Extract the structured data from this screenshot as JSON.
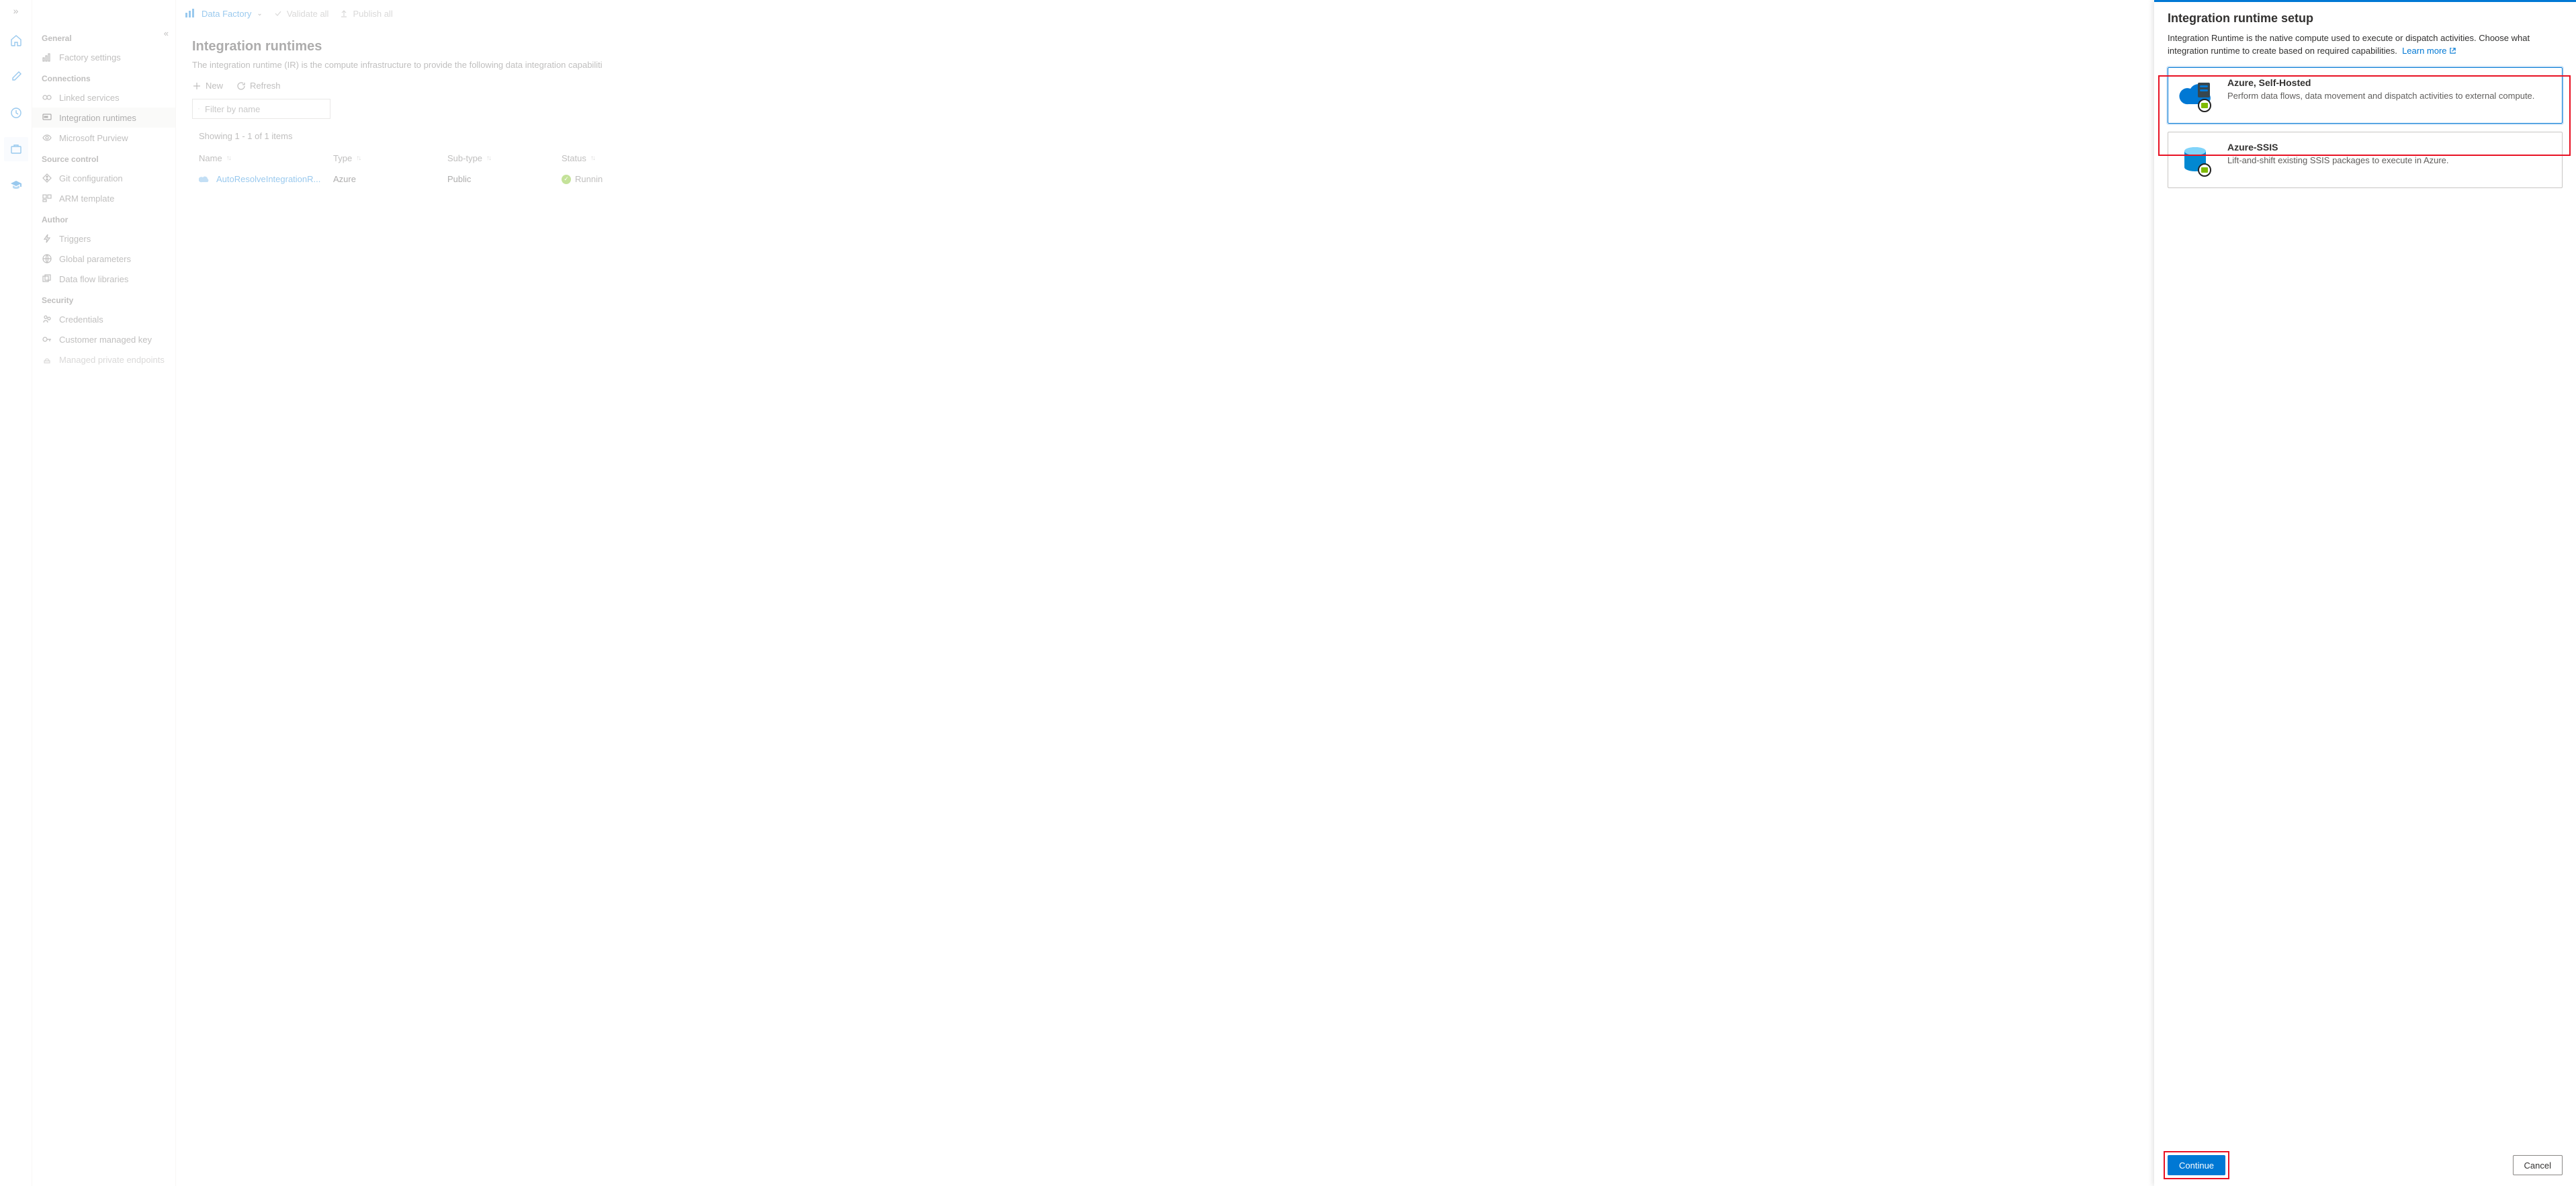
{
  "topbar": {
    "brand": "Data Factory",
    "validate": "Validate all",
    "publish": "Publish all"
  },
  "sidebar": {
    "groups": [
      {
        "title": "General",
        "items": [
          {
            "label": "Factory settings"
          }
        ]
      },
      {
        "title": "Connections",
        "items": [
          {
            "label": "Linked services"
          },
          {
            "label": "Integration runtimes",
            "active": true
          },
          {
            "label": "Microsoft Purview"
          }
        ]
      },
      {
        "title": "Source control",
        "items": [
          {
            "label": "Git configuration"
          },
          {
            "label": "ARM template"
          }
        ]
      },
      {
        "title": "Author",
        "items": [
          {
            "label": "Triggers"
          },
          {
            "label": "Global parameters"
          },
          {
            "label": "Data flow libraries"
          }
        ]
      },
      {
        "title": "Security",
        "items": [
          {
            "label": "Credentials"
          },
          {
            "label": "Customer managed key"
          },
          {
            "label": "Managed private endpoints",
            "disabled": true
          }
        ]
      }
    ]
  },
  "main": {
    "title": "Integration runtimes",
    "desc": "The integration runtime (IR) is the compute infrastructure to provide the following data integration capabiliti",
    "new": "New",
    "refresh": "Refresh",
    "filter_placeholder": "Filter by name",
    "showing": "Showing 1 - 1 of 1 items",
    "columns": {
      "name": "Name",
      "type": "Type",
      "subtype": "Sub-type",
      "status": "Status"
    },
    "rows": [
      {
        "name": "AutoResolveIntegrationR...",
        "type": "Azure",
        "subtype": "Public",
        "status": "Runnin"
      }
    ]
  },
  "panel": {
    "title": "Integration runtime setup",
    "intro": "Integration Runtime is the native compute used to execute or dispatch activities. Choose what integration runtime to create based on required capabilities.",
    "learn_more": "Learn more",
    "cards": [
      {
        "title": "Azure, Self-Hosted",
        "desc": "Perform data flows, data movement and dispatch activities to external compute.",
        "selected": true
      },
      {
        "title": "Azure-SSIS",
        "desc": "Lift-and-shift existing SSIS packages to execute in Azure."
      }
    ],
    "continue": "Continue",
    "cancel": "Cancel"
  }
}
